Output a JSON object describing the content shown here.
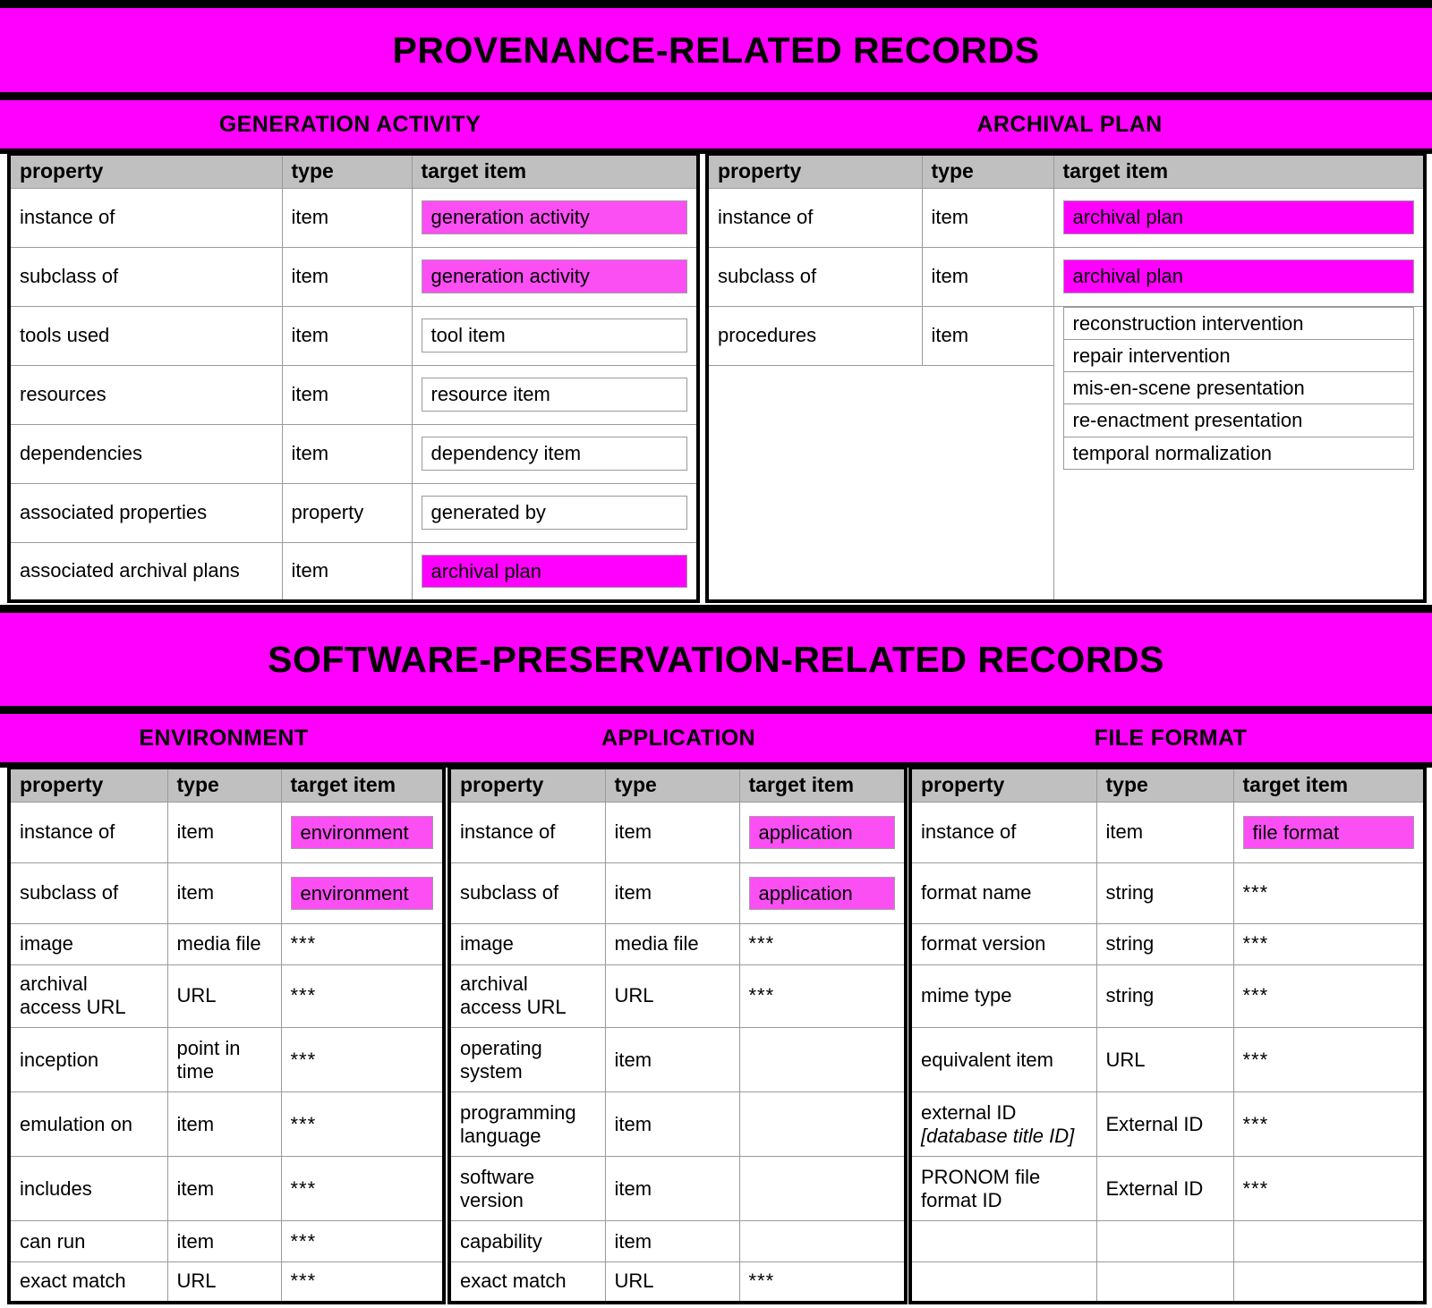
{
  "colors": {
    "banner": "#ff00ff",
    "chip_light": "#fb4ff4",
    "chip_bright": "#ff00ff",
    "header_row": "#c0c0c0",
    "border": "#000000"
  },
  "sections": {
    "provenance": {
      "title": "PROVENANCE-RELATED RECORDS",
      "subheadings": {
        "generation_activity": "GENERATION ACTIVITY",
        "archival_plan": "ARCHIVAL PLAN"
      },
      "generation_activity_table": {
        "columns": [
          "property",
          "type",
          "target item"
        ],
        "rows": [
          {
            "property": "instance of",
            "type": "item",
            "target": "generation activity",
            "style": "chip-light"
          },
          {
            "property": "subclass of",
            "type": "item",
            "target": "generation activity",
            "style": "chip-light"
          },
          {
            "property": "tools used",
            "type": "item",
            "target": "tool item",
            "style": "chip-plain"
          },
          {
            "property": "resources",
            "type": "item",
            "target": "resource item",
            "style": "chip-plain"
          },
          {
            "property": "dependencies",
            "type": "item",
            "target": "dependency item",
            "style": "chip-plain"
          },
          {
            "property": "associated properties",
            "type": "property",
            "target": "generated by",
            "style": "chip-plain"
          },
          {
            "property": "associated archival plans",
            "type": "item",
            "target": "archival plan",
            "style": "chip-bright"
          }
        ]
      },
      "archival_plan_table": {
        "columns": [
          "property",
          "type",
          "target item"
        ],
        "rows": [
          {
            "property": "instance of",
            "type": "item",
            "target": "archival plan",
            "style": "chip-bright"
          },
          {
            "property": "subclass of",
            "type": "item",
            "target": "archival plan",
            "style": "chip-bright"
          },
          {
            "property": "procedures",
            "type": "item",
            "style": "chip-list",
            "targets": [
              "reconstruction intervention",
              "repair intervention",
              "mis-en-scene presentation",
              "re-enactment presentation",
              "temporal normalization"
            ]
          }
        ]
      }
    },
    "software_preservation": {
      "title": "SOFTWARE-PRESERVATION-RELATED RECORDS",
      "subheadings": {
        "environment": "ENVIRONMENT",
        "application": "APPLICATION",
        "file_format": "FILE FORMAT"
      },
      "environment_table": {
        "columns": [
          "property",
          "type",
          "target item"
        ],
        "rows": [
          {
            "property": "instance of",
            "type": "item",
            "target": "environment",
            "style": "chip-light"
          },
          {
            "property": "subclass of",
            "type": "item",
            "target": "environment",
            "style": "chip-light"
          },
          {
            "property": "image",
            "type": "media file",
            "target": "***",
            "style": "plain"
          },
          {
            "property": "archival\naccess URL",
            "type": "URL",
            "target": "***",
            "style": "plain"
          },
          {
            "property": "inception",
            "type": "point in\ntime",
            "target": "***",
            "style": "plain"
          },
          {
            "property": "emulation on",
            "type": "item",
            "target": "***",
            "style": "plain"
          },
          {
            "property": "includes",
            "type": "item",
            "target": "***",
            "style": "plain"
          },
          {
            "property": "can run",
            "type": "item",
            "target": "***",
            "style": "plain"
          },
          {
            "property": "exact match",
            "type": "URL",
            "target": "***",
            "style": "plain"
          }
        ]
      },
      "application_table": {
        "columns": [
          "property",
          "type",
          "target item"
        ],
        "rows": [
          {
            "property": "instance of",
            "type": "item",
            "target": "application",
            "style": "chip-light"
          },
          {
            "property": "subclass of",
            "type": "item",
            "target": "application",
            "style": "chip-light"
          },
          {
            "property": "image",
            "type": "media file",
            "target": "***",
            "style": "plain"
          },
          {
            "property": "archival\naccess URL",
            "type": "URL",
            "target": "***",
            "style": "plain"
          },
          {
            "property": "operating\nsystem",
            "type": "item",
            "target": "",
            "style": "plain"
          },
          {
            "property": "programming\nlanguage",
            "type": "item",
            "target": "",
            "style": "plain"
          },
          {
            "property": "software\nversion",
            "type": "item",
            "target": "",
            "style": "plain"
          },
          {
            "property": "capability",
            "type": "item",
            "target": "",
            "style": "plain"
          },
          {
            "property": "exact match",
            "type": "URL",
            "target": "***",
            "style": "plain"
          }
        ]
      },
      "file_format_table": {
        "columns": [
          "property",
          "type",
          "target item"
        ],
        "rows": [
          {
            "property": "instance of",
            "type": "item",
            "target": "file format",
            "style": "chip-light"
          },
          {
            "property": "format name",
            "type": "string",
            "target": "***",
            "style": "plain"
          },
          {
            "property": "format version",
            "type": "string",
            "target": "***",
            "style": "plain"
          },
          {
            "property": "mime type",
            "type": "string",
            "target": "***",
            "style": "plain"
          },
          {
            "property": "equivalent item",
            "type": "URL",
            "target": "***",
            "style": "plain"
          },
          {
            "property": "external ID",
            "property_sub": "[database title ID]",
            "type": "External ID",
            "target": "***",
            "style": "plain"
          },
          {
            "property": "PRONOM file\nformat ID",
            "type": "External ID",
            "target": "***",
            "style": "plain"
          },
          {
            "property": "",
            "type": "",
            "target": "",
            "style": "plain"
          },
          {
            "property": "",
            "type": "",
            "target": "",
            "style": "plain"
          }
        ]
      }
    }
  }
}
